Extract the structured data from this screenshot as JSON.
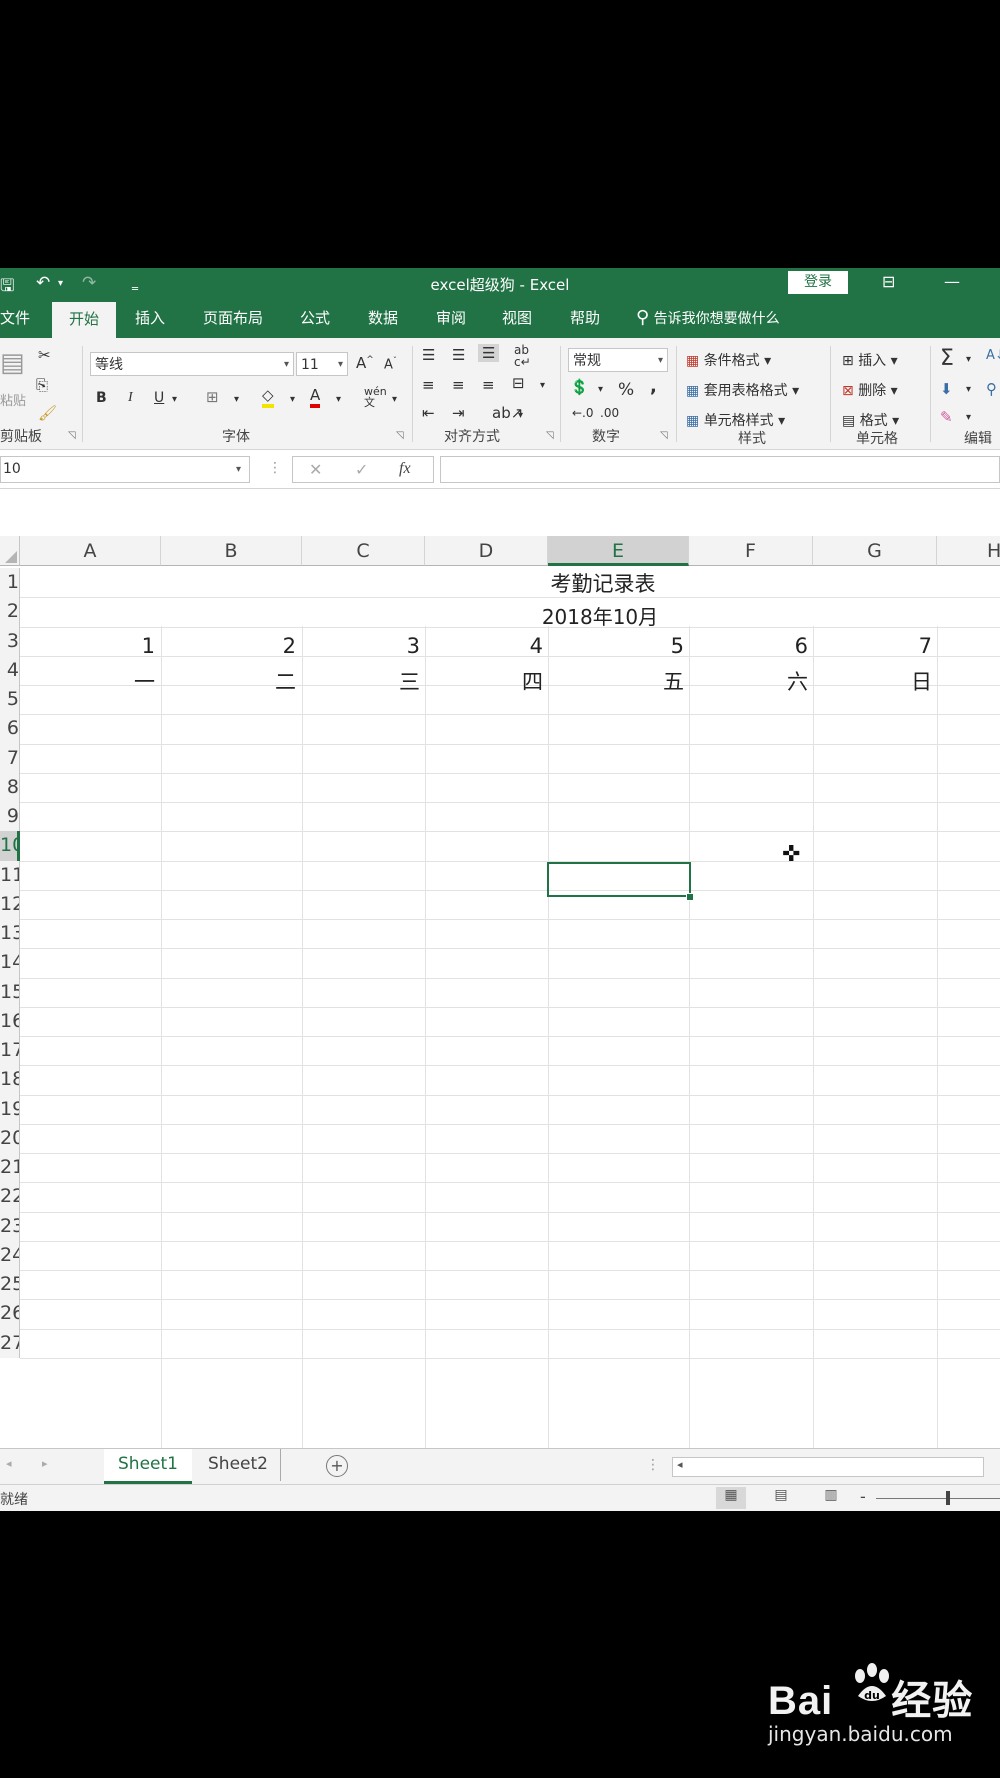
{
  "titlebar": {
    "title": "excel超级狗 - Excel",
    "login": "登录",
    "qa_save": "🖫",
    "qa_undo": "↶",
    "qa_redo": "↷",
    "qa_customize": "‗",
    "ribbon_display_icon": "⊟",
    "minimize": "—"
  },
  "tabs": [
    "文件",
    "开始",
    "插入",
    "页面布局",
    "公式",
    "数据",
    "审阅",
    "视图",
    "帮助"
  ],
  "active_tab": "开始",
  "tellme": "告诉我你想要做什么",
  "ribbon": {
    "clipboard": {
      "label": "剪贴板",
      "paste": "粘贴"
    },
    "font": {
      "label": "字体",
      "name": "等线",
      "size": "11",
      "bold": "B",
      "italic": "I",
      "underline": "U",
      "grow": "A^",
      "shrink": "A˅",
      "wen": "wén"
    },
    "alignment": {
      "label": "对齐方式"
    },
    "number": {
      "label": "数字",
      "format": "常规",
      "percent": "%",
      "comma": ","
    },
    "styles": {
      "label": "样式",
      "conditional": "条件格式",
      "table": "套用表格格式",
      "cell": "单元格样式"
    },
    "cells": {
      "label": "单元格",
      "insert": "插入",
      "delete": "删除",
      "format": "格式"
    },
    "editing": {
      "label": "编辑",
      "sum": "Σ"
    }
  },
  "formula_bar": {
    "name_box": "10",
    "cancel": "✕",
    "enter": "✓",
    "fx": "fx",
    "value": ""
  },
  "columns": [
    "A",
    "B",
    "C",
    "D",
    "E",
    "F",
    "G",
    "H"
  ],
  "selected_column": "E",
  "rows": [
    "1",
    "2",
    "3",
    "4",
    "5",
    "6",
    "7",
    "8",
    "9",
    "10",
    "11",
    "12",
    "13",
    "14",
    "15",
    "16",
    "17",
    "18",
    "19",
    "20",
    "21",
    "22",
    "23",
    "24",
    "25",
    "26",
    "27"
  ],
  "selected_row": "10",
  "sheet": {
    "title": "考勤记录表",
    "month": "2018年10月",
    "day_numbers": [
      "1",
      "2",
      "3",
      "4",
      "5",
      "6",
      "7"
    ],
    "weekdays": [
      "一",
      "二",
      "三",
      "四",
      "五",
      "六",
      "日"
    ]
  },
  "sheet_tabs": [
    "Sheet1",
    "Sheet2"
  ],
  "active_sheet": "Sheet1",
  "add_sheet": "+",
  "status": {
    "text": "就绪",
    "zoom_minus": "-"
  },
  "watermark": {
    "logo_left": "Bai",
    "logo_right": "经验",
    "url": "jingyan.baidu.com"
  },
  "colors": {
    "accent": "#217346",
    "ribbon_bg": "#f3f3f3",
    "gridline": "#e2e2e2"
  }
}
